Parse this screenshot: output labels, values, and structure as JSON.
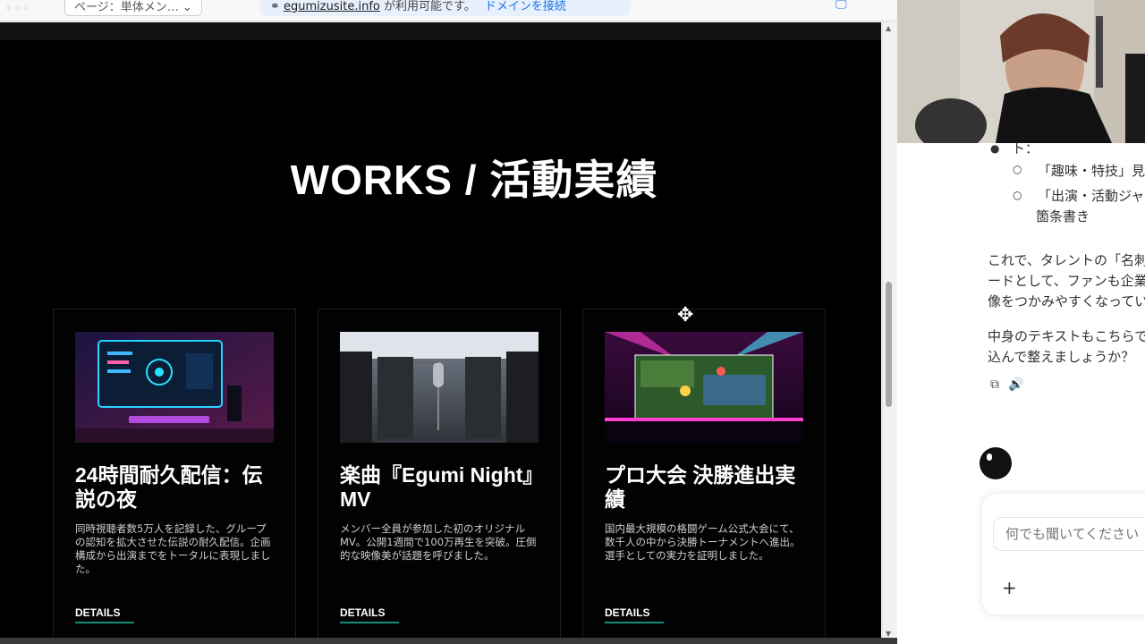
{
  "browser": {
    "page_select": "ページ：単体メン… ⌄",
    "domain": "egumizusite.info",
    "domain_msg": "が利用可能です。",
    "connect": "ドメインを接続"
  },
  "works": {
    "title": "WORKS / 活動実績",
    "cards": [
      {
        "title": "24時間耐久配信：伝説の夜",
        "desc": "同時視聴者数5万人を記録した、グループの認知を拡大させた伝説の耐久配信。企画構成から出演までをトータルに表現しました。",
        "details": "DETAILS"
      },
      {
        "title": "楽曲『Egumi Night』MV",
        "desc": "メンバー全員が参加した初のオリジナルMV。公開1週間で100万再生を突破。圧倒的な映像美が話題を呼びました。",
        "details": "DETAILS"
      },
      {
        "title": "プロ大会 決勝進出実績",
        "desc": "国内最大規模の格闘ゲーム公式大会にて、数千人の中から決勝トーナメントへ進出。選手としての実力を証明しました。",
        "details": "DETAILS"
      }
    ]
  },
  "chat": {
    "line_top": "ト：",
    "sub1": "「趣味・特技」見",
    "sub2a": "「出演・活動ジャ",
    "sub2b": "箇条書き",
    "p1a": "これで、タレントの「名刺",
    "p1b": "ードとして、ファンも企業",
    "p1c": "像をつかみやすくなってい",
    "p2a": "中身のテキストもこちらで",
    "p2b": "込んで整えましょうか？",
    "input_placeholder": "何でも聞いてください",
    "plus": "+",
    "icons": "⧉🔊"
  },
  "colors": {
    "accent_underline": "#0e8f7d",
    "page_bg": "#000000"
  }
}
